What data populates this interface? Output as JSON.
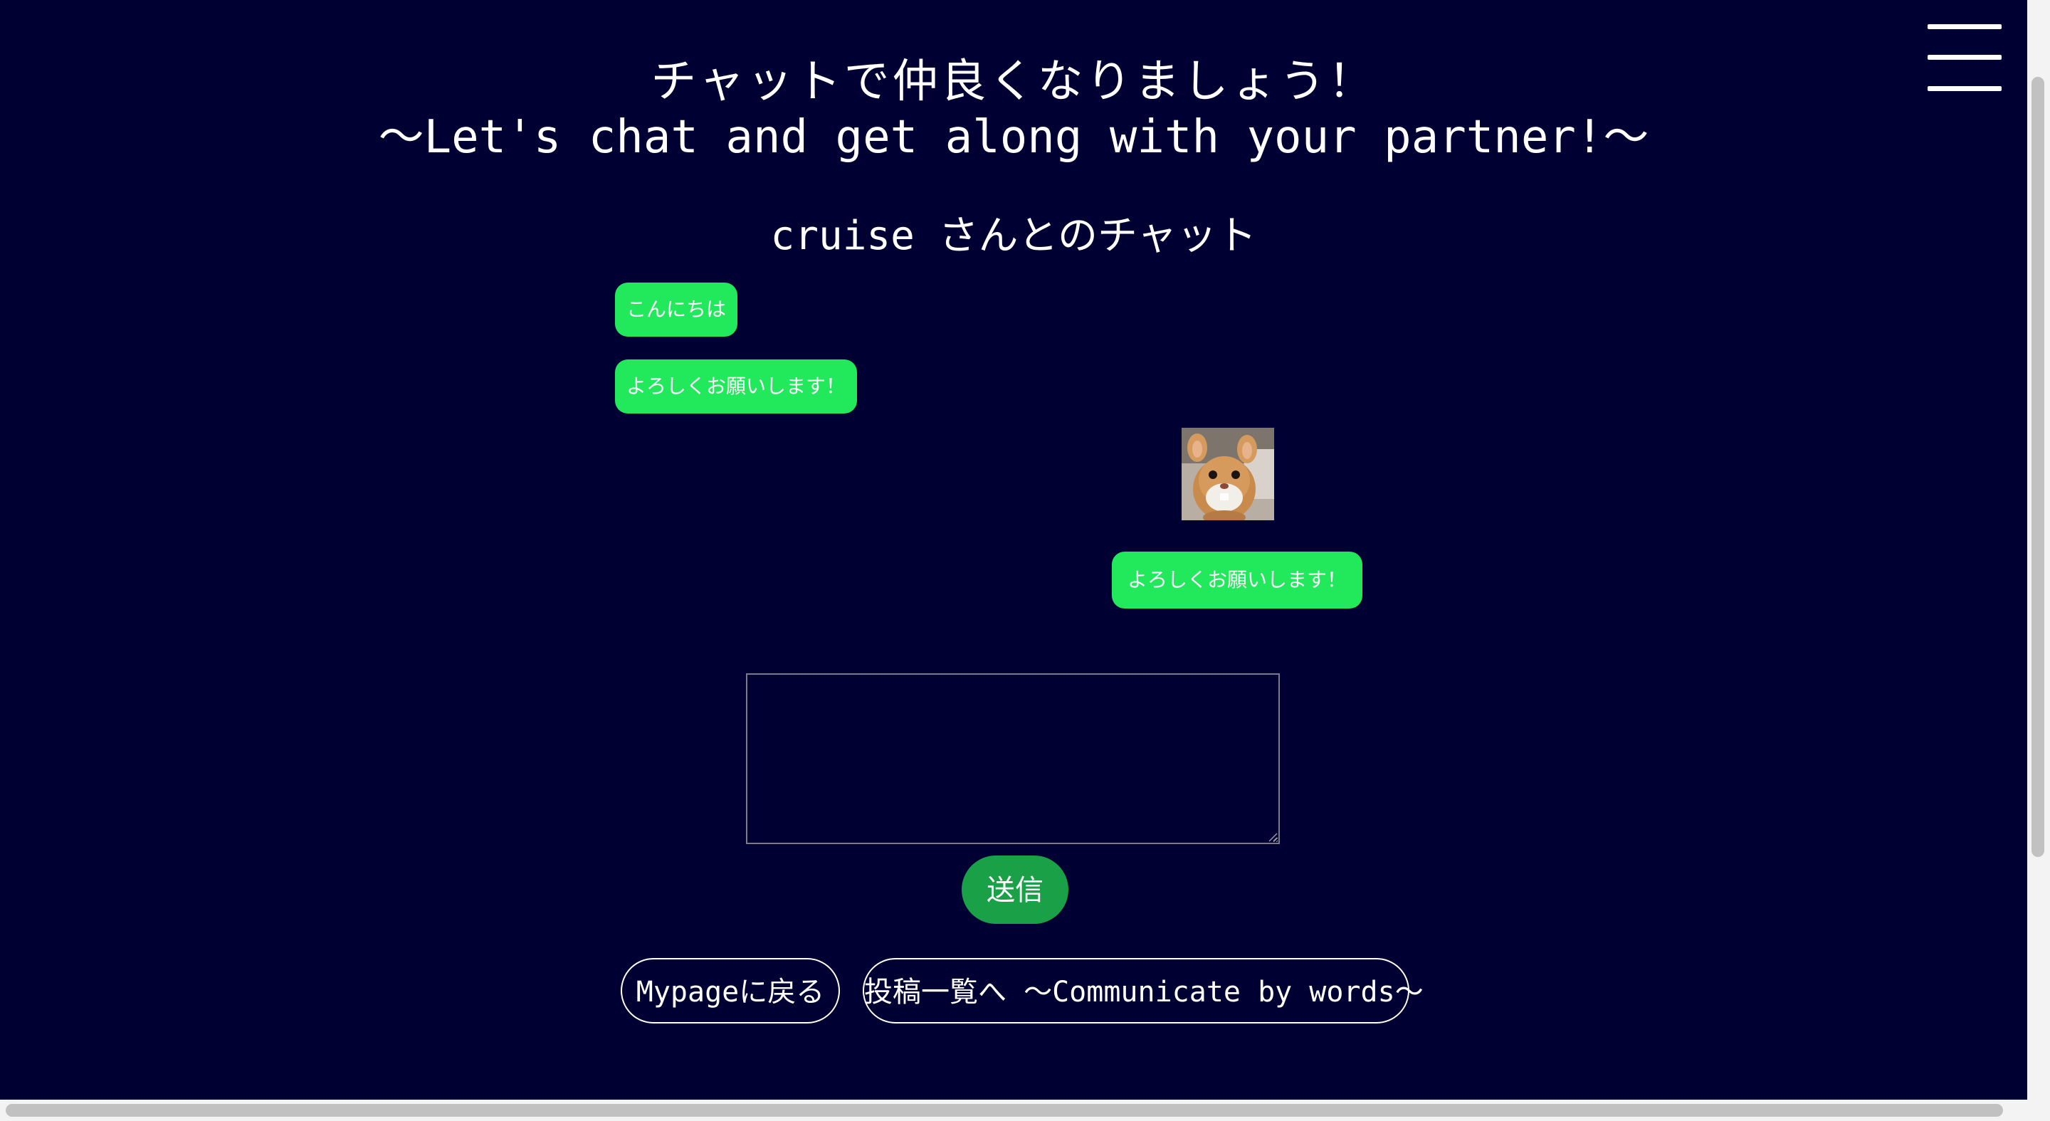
{
  "header": {
    "title_jp": "チャットで仲良くなりましょう！",
    "title_en": "～Let's chat and get along with your partner!～"
  },
  "chat": {
    "title": "cruise さんとのチャット",
    "messages": [
      {
        "side": "left",
        "text": "こんにちは"
      },
      {
        "side": "left",
        "text": "よろしくお願いします！"
      },
      {
        "side": "right",
        "type": "image",
        "text": ""
      },
      {
        "side": "right",
        "text": "よろしくお願いします！"
      }
    ]
  },
  "form": {
    "input_value": "",
    "send_label": "送信"
  },
  "nav": {
    "mypage_label": "Mypageに戻る",
    "posts_label": "投稿一覧へ ～Communicate by words～"
  },
  "icons": {
    "menu": "hamburger-menu-icon"
  },
  "colors": {
    "background": "#000033",
    "bubble": "#22e85c",
    "send_button": "#1aa046",
    "text": "#ffffff"
  }
}
